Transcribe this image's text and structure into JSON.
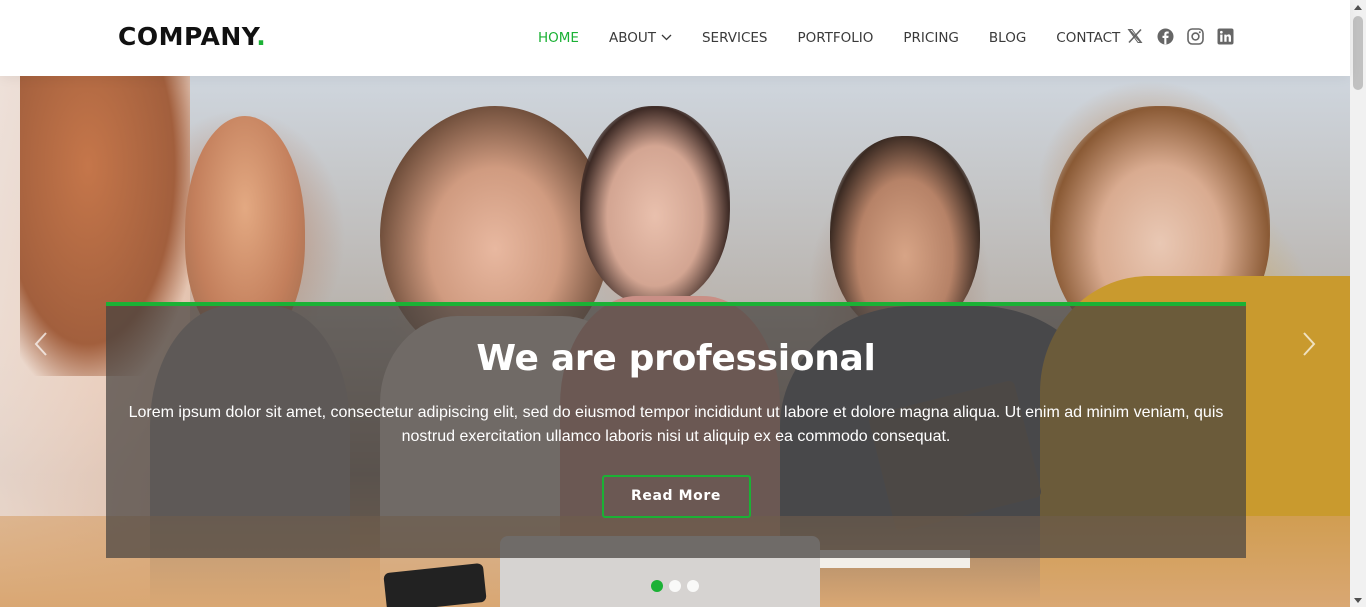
{
  "brand": {
    "name": "COMPANY",
    "dot": ".",
    "accent_color": "#1bb135"
  },
  "nav": {
    "items": [
      {
        "label": "HOME",
        "active": true
      },
      {
        "label": "ABOUT",
        "has_dropdown": true
      },
      {
        "label": "SERVICES"
      },
      {
        "label": "PORTFOLIO"
      },
      {
        "label": "PRICING"
      },
      {
        "label": "BLOG"
      },
      {
        "label": "CONTACT"
      }
    ]
  },
  "social": [
    "x-icon",
    "facebook-icon",
    "instagram-icon",
    "linkedin-icon"
  ],
  "hero": {
    "title": "We are professional",
    "text": "Lorem ipsum dolor sit amet, consectetur adipiscing elit, sed do eiusmod tempor incididunt ut labore et dolore magna aliqua. Ut enim ad minim veniam, quis nostrud exercitation ullamco laboris nisi ut aliquip ex ea commodo consequat.",
    "button_label": "Read More",
    "slide_count": 3,
    "active_slide": 1,
    "prev_icon": "chevron-left-icon",
    "next_icon": "chevron-right-icon"
  }
}
